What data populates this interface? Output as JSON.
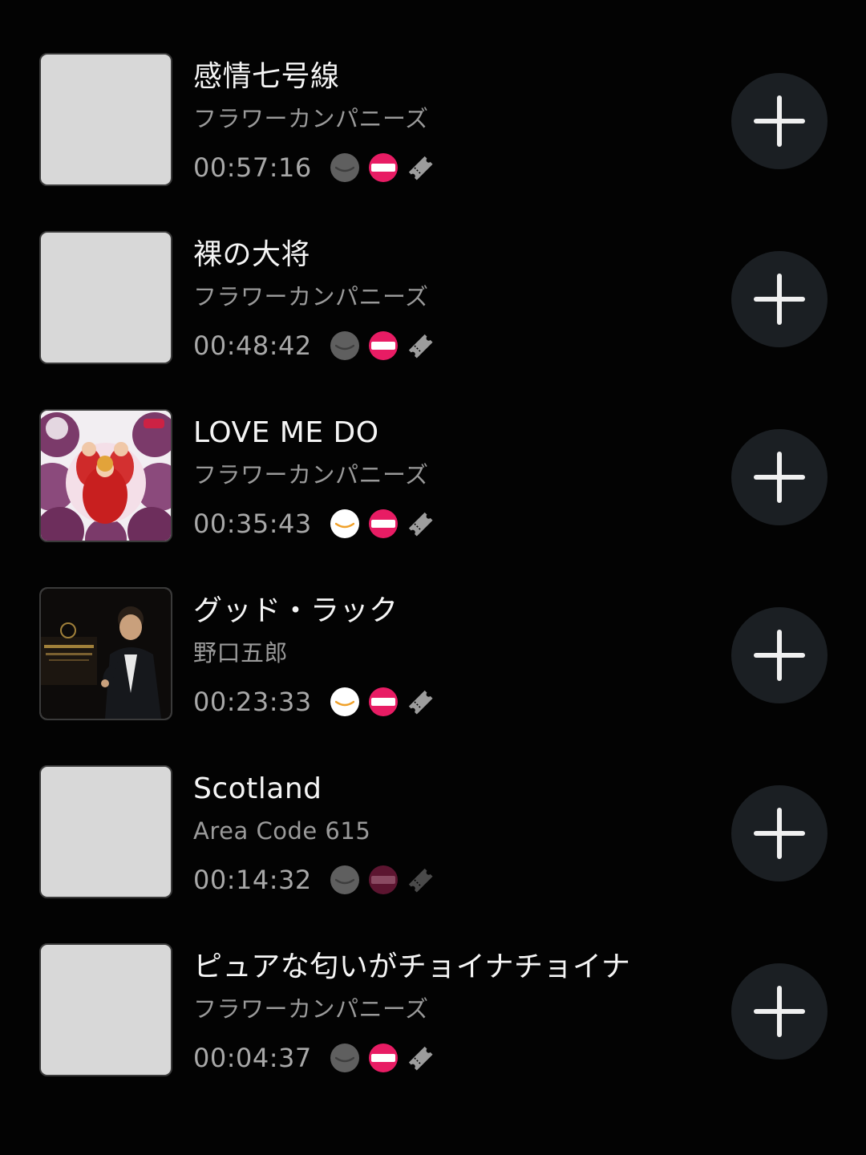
{
  "tracks": [
    {
      "title": "感情七号線",
      "artist": "フラワーカンパニーズ",
      "duration": "00:57:16",
      "artwork": "placeholder",
      "amazon_available": false,
      "ticket_available": true,
      "clip_available": true
    },
    {
      "title": "裸の大将",
      "artist": "フラワーカンパニーズ",
      "duration": "00:48:42",
      "artwork": "placeholder",
      "amazon_available": false,
      "ticket_available": true,
      "clip_available": true
    },
    {
      "title": "LOVE ME DO",
      "artist": "フラワーカンパニーズ",
      "duration": "00:35:43",
      "artwork": "album-art-red",
      "amazon_available": true,
      "ticket_available": true,
      "clip_available": true
    },
    {
      "title": "グッド・ラック",
      "artist": "野口五郎",
      "duration": "00:23:33",
      "artwork": "album-art-dark",
      "amazon_available": true,
      "ticket_available": true,
      "clip_available": true
    },
    {
      "title": "Scotland",
      "artist": "Area Code 615",
      "duration": "00:14:32",
      "artwork": "placeholder",
      "amazon_available": false,
      "ticket_available": false,
      "clip_available": false
    },
    {
      "title": "ピュアな匂いがチョイナチョイナ",
      "artist": "フラワーカンパニーズ",
      "duration": "00:04:37",
      "artwork": "placeholder",
      "amazon_available": false,
      "ticket_available": true,
      "clip_available": true
    }
  ],
  "icons": {
    "amazon": "amazon-smile-icon",
    "ticket": "ticket-service-icon",
    "clip": "clip-ticket-icon",
    "add": "plus-icon"
  },
  "colors": {
    "background": "#030303",
    "ticket_pink": "#e81c64",
    "amazon_orange": "#f0a12a",
    "add_button_bg": "#1b1f23"
  }
}
